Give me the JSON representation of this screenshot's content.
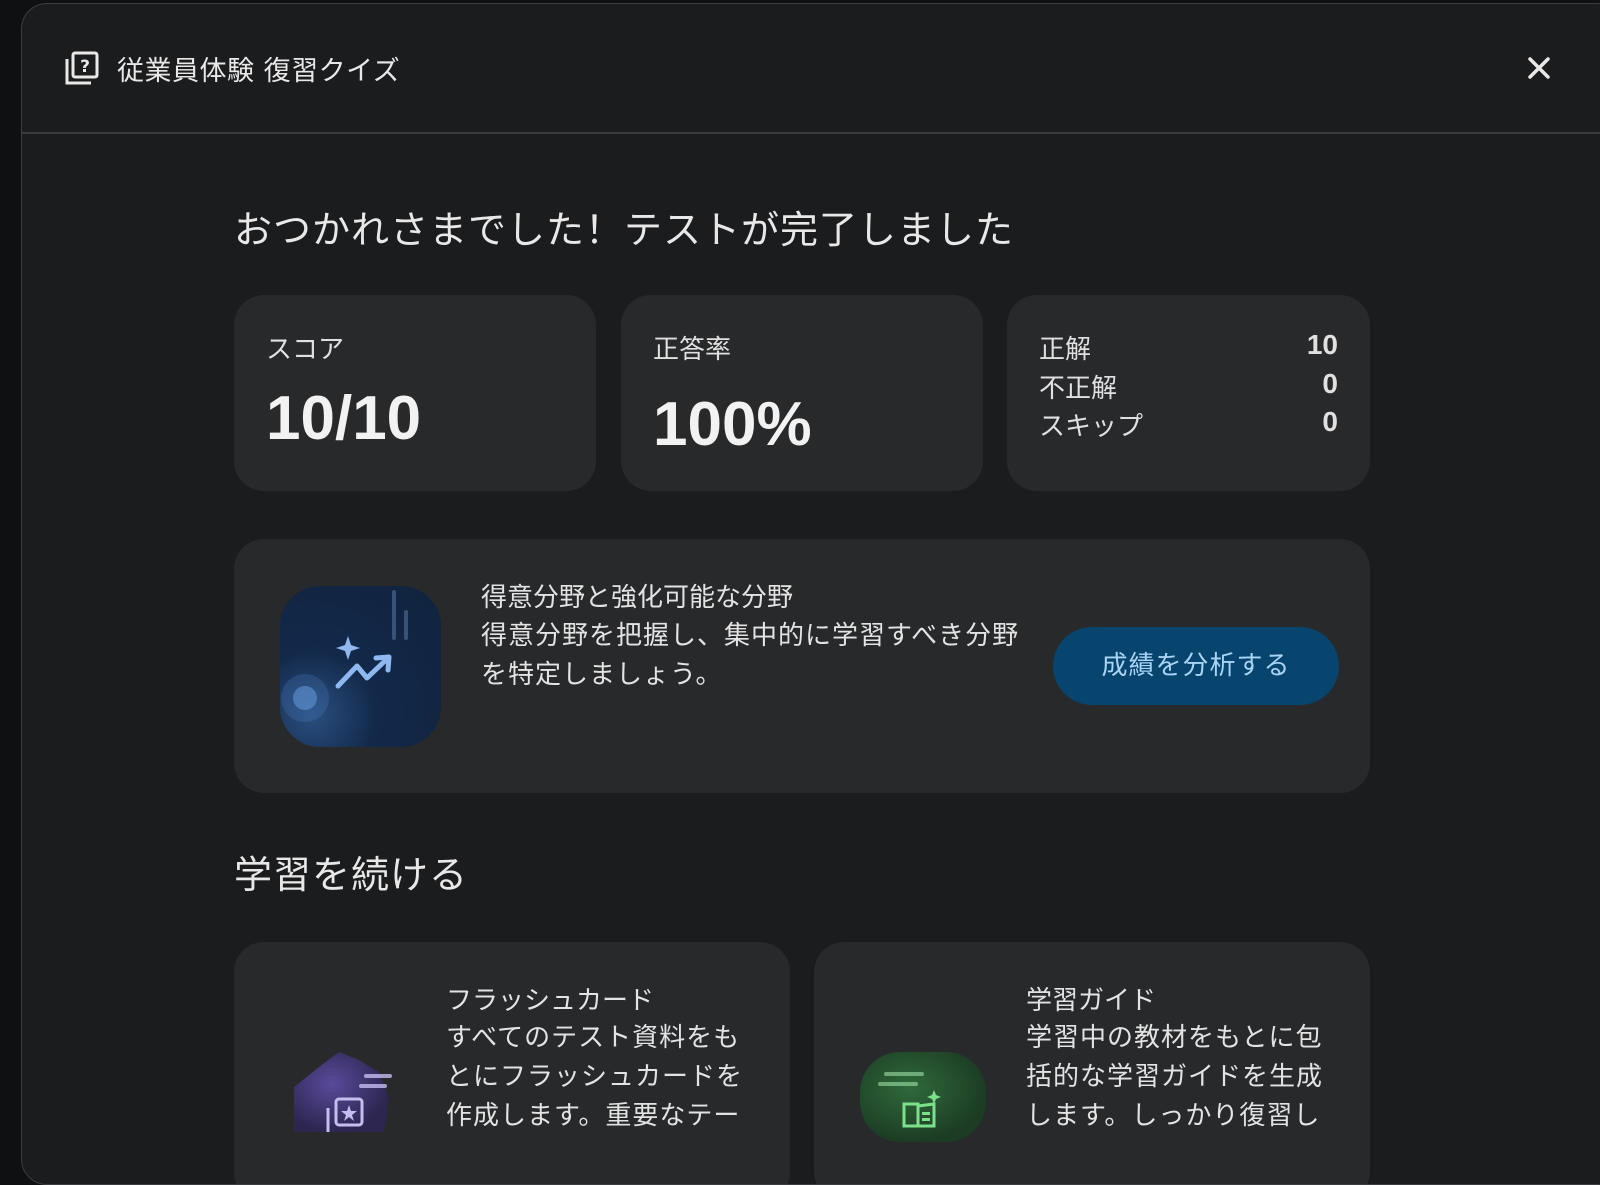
{
  "dialog": {
    "title": "従業員体験 復習クイズ",
    "icon": "quiz-icon",
    "close_icon": "close-icon"
  },
  "completion": {
    "title": "おつかれさまでした！テストが完了しました"
  },
  "stats": {
    "score_label": "スコア",
    "score_value": "10/10",
    "accuracy_label": "正答率",
    "accuracy_value": "100%",
    "breakdown": [
      {
        "label": "正解",
        "value": "10"
      },
      {
        "label": "不正解",
        "value": "0"
      },
      {
        "label": "スキップ",
        "value": "0"
      }
    ]
  },
  "analysis": {
    "title": "得意分野と強化可能な分野",
    "description": "得意分野を把握し、集中的に学習すべき分野を特定しましょう。",
    "button_label": "成績を分析する",
    "icon": "sparkle-trend-icon"
  },
  "continue_learning": {
    "title": "学習を続ける",
    "cards": [
      {
        "title": "フラッシュカード",
        "description": "すべてのテスト資料をもとにフラッシュカードを作成します。重要なテー",
        "icon": "flashcard-icon"
      },
      {
        "title": "学習ガイド",
        "description": "学習中の教材をもとに包括的な学習ガイドを生成します。しっかり復習し",
        "icon": "study-guide-icon"
      }
    ]
  },
  "colors": {
    "background": "#1b1c1e",
    "card": "#27292b",
    "button": "#07456f",
    "button_text": "#a9d4f5"
  }
}
